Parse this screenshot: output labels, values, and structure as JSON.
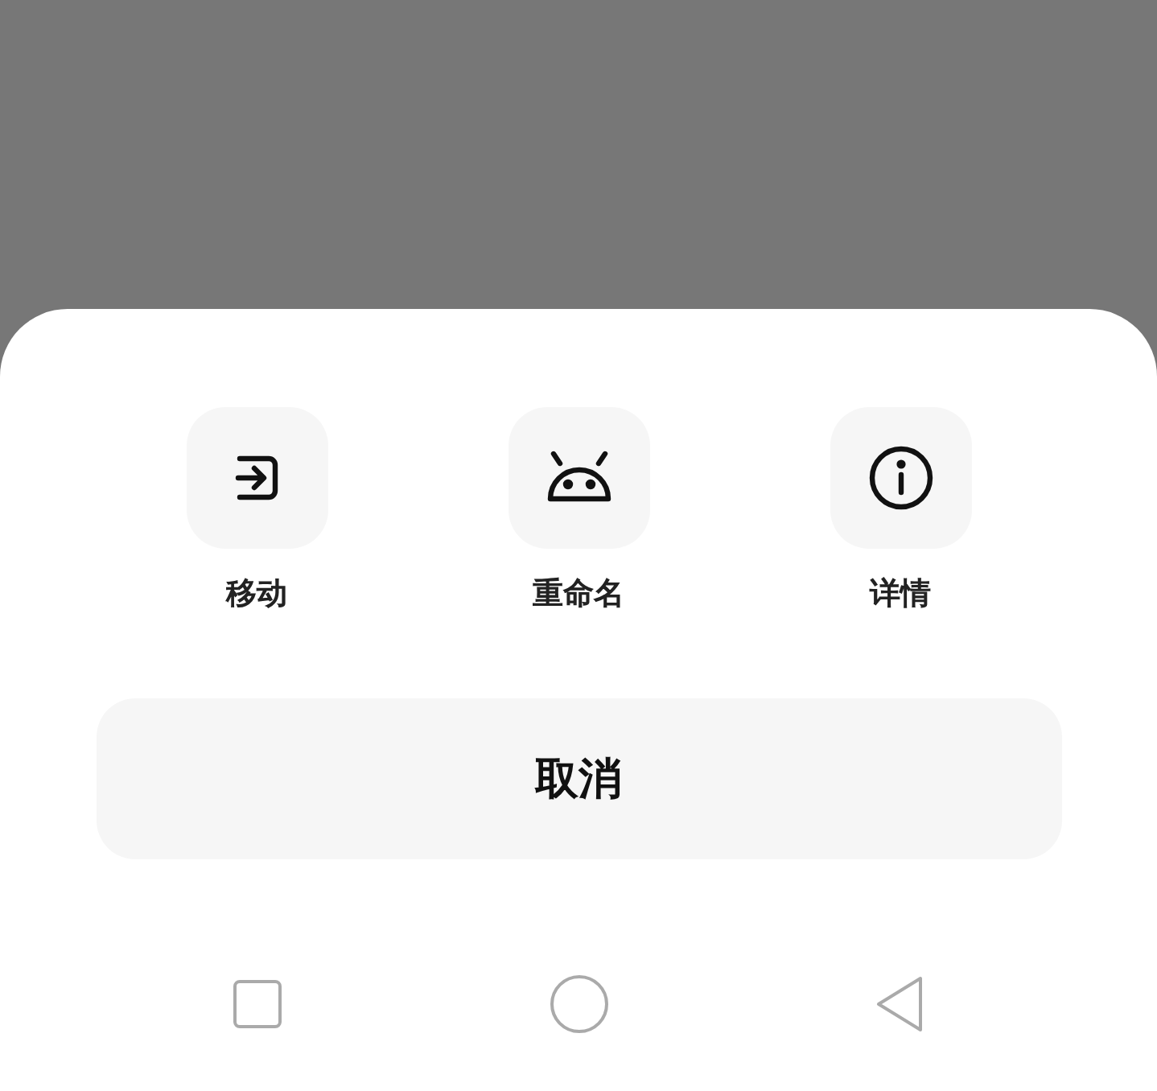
{
  "actions": [
    {
      "kind": "move",
      "label": "移动"
    },
    {
      "kind": "robot",
      "label": "重命名"
    },
    {
      "kind": "info",
      "label": "详情"
    }
  ],
  "cancel_button": {
    "label": "取消"
  }
}
